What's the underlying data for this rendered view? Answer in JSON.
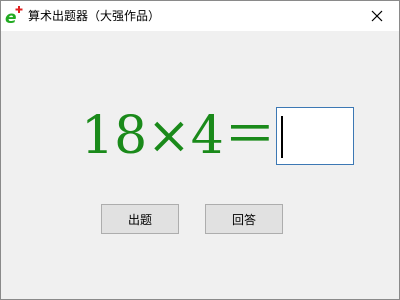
{
  "window": {
    "title": "算术出题器（大强作品）"
  },
  "icons": {
    "app": "app-logo-icon",
    "close": "close-icon"
  },
  "equation": {
    "text": "18×4＝",
    "operand1": 18,
    "operator": "×",
    "operand2": 4
  },
  "answer_input": {
    "value": ""
  },
  "buttons": {
    "generate_label": "出题",
    "answer_label": "回答"
  },
  "colors": {
    "equation_text": "#1a8a1a",
    "input_border": "#3c78b4",
    "logo_green": "#22aa22",
    "logo_red": "#e02020"
  }
}
